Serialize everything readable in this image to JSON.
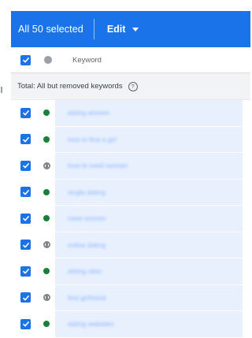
{
  "topbar": {
    "selection_label": "All 50 selected",
    "edit_label": "Edit"
  },
  "table": {
    "column_keyword": "Keyword",
    "total_label": "Total: All but removed keywords",
    "rows": [
      {
        "keyword": "dating women",
        "status": "enabled"
      },
      {
        "keyword": "how to find a girl",
        "status": "enabled"
      },
      {
        "keyword": "how to meet women",
        "status": "paused"
      },
      {
        "keyword": "single dating",
        "status": "enabled"
      },
      {
        "keyword": "meet women",
        "status": "enabled"
      },
      {
        "keyword": "online dating",
        "status": "paused"
      },
      {
        "keyword": "dating sites",
        "status": "enabled"
      },
      {
        "keyword": "find girlfriend",
        "status": "paused"
      },
      {
        "keyword": "dating websites",
        "status": "enabled"
      }
    ]
  },
  "colors": {
    "accent": "#1a73e8",
    "enabled": "#188038",
    "paused": "#80868b",
    "selected_row": "#e8f0fe"
  }
}
